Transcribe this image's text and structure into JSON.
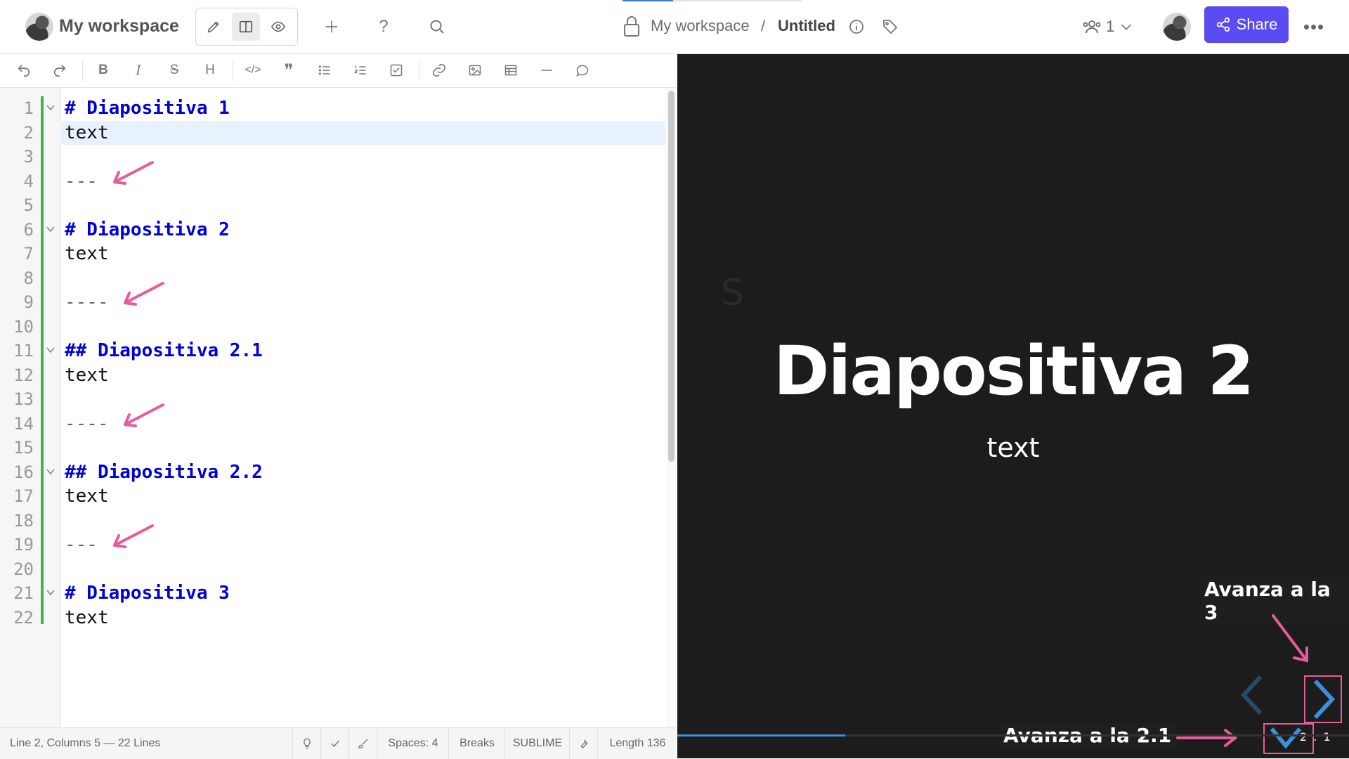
{
  "header": {
    "workspace_name": "My workspace",
    "breadcrumb_workspace": "My workspace",
    "breadcrumb_separator": "/",
    "document_title": "Untitled",
    "collaborators_count": "1",
    "share_label": "Share",
    "more_label": "•••",
    "help_label": "?",
    "active_mode": "both"
  },
  "editor": {
    "lines": [
      {
        "num": "1",
        "text": "# Diapositiva 1",
        "kind": "h",
        "fold": true
      },
      {
        "num": "2",
        "text": "text",
        "kind": "t",
        "active": true
      },
      {
        "num": "3",
        "text": "",
        "kind": "t"
      },
      {
        "num": "4",
        "text": "---",
        "kind": "hr",
        "arrow": true
      },
      {
        "num": "5",
        "text": "",
        "kind": "t"
      },
      {
        "num": "6",
        "text": "# Diapositiva 2",
        "kind": "h",
        "fold": true
      },
      {
        "num": "7",
        "text": "text",
        "kind": "t"
      },
      {
        "num": "8",
        "text": "",
        "kind": "t"
      },
      {
        "num": "9",
        "text": "----",
        "kind": "hr",
        "arrow": true
      },
      {
        "num": "10",
        "text": "",
        "kind": "t"
      },
      {
        "num": "11",
        "text": "## Diapositiva 2.1",
        "kind": "h",
        "fold": true
      },
      {
        "num": "12",
        "text": "text",
        "kind": "t"
      },
      {
        "num": "13",
        "text": "",
        "kind": "t"
      },
      {
        "num": "14",
        "text": "----",
        "kind": "hr",
        "arrow": true
      },
      {
        "num": "15",
        "text": "",
        "kind": "t"
      },
      {
        "num": "16",
        "text": "## Diapositiva 2.2",
        "kind": "h",
        "fold": true
      },
      {
        "num": "17",
        "text": "text",
        "kind": "t"
      },
      {
        "num": "18",
        "text": "",
        "kind": "t"
      },
      {
        "num": "19",
        "text": "---",
        "kind": "hr",
        "arrow": true
      },
      {
        "num": "20",
        "text": "",
        "kind": "t"
      },
      {
        "num": "21",
        "text": "# Diapositiva 3",
        "kind": "h",
        "fold": true
      },
      {
        "num": "22",
        "text": "text",
        "kind": "t"
      }
    ]
  },
  "status": {
    "position": "Line 2, Columns 5 — 22 Lines",
    "spaces": "Spaces: 4",
    "breaks": "Breaks",
    "keymap": "SUBLIME",
    "length": "Length 136"
  },
  "preview": {
    "ghost_letter": "S",
    "slide_title": "Diapositiva 2",
    "slide_text": "text",
    "callout_next": "Avanza a la 3",
    "callout_down": "Avanza a la 2.1",
    "slide_counter": "2 . 1",
    "progress": 0.25
  },
  "colors": {
    "accent": "#5a4cf2",
    "heading": "#0000d8",
    "annotation_pink": "#e75a9b",
    "nav_blue": "#3d8fd8",
    "preview_bg": "#1c1c1c"
  }
}
